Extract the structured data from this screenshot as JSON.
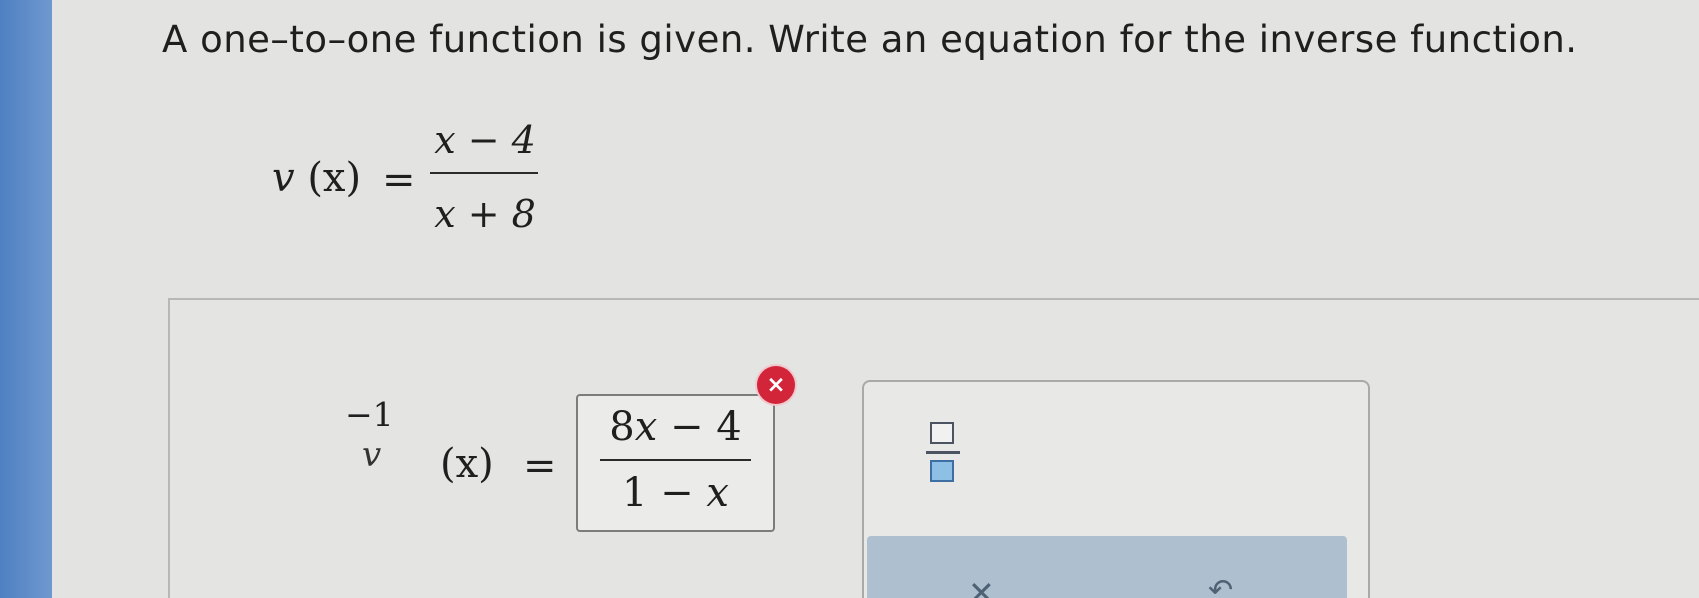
{
  "prompt": {
    "text": "A one–to–one function is given. Write an equation for the inverse function."
  },
  "given_function": {
    "name": "v",
    "argument": "(x)",
    "equals": "=",
    "numerator": "x − 4",
    "denominator": "x + 8"
  },
  "answer": {
    "function_name": "v",
    "exponent": "−1",
    "argument": "(x)",
    "equals": "=",
    "numerator_coefficient": "8",
    "numerator_variable": "x",
    "numerator_rest": " − 4",
    "denominator_lead": "1 − ",
    "denominator_variable": "x",
    "status_icon": "incorrect-x-icon",
    "status_symbol": "×",
    "status_color": "#d2253a"
  },
  "tools": {
    "fraction_icon": "fraction-icon",
    "clear_icon": "clear-x-icon",
    "clear_symbol": "✕",
    "undo_icon": "undo-icon",
    "undo_symbol": "↶"
  },
  "colors": {
    "left_bar": "#4f80c2",
    "background": "#e3e3e1",
    "action_bar": "#aebfcf"
  }
}
